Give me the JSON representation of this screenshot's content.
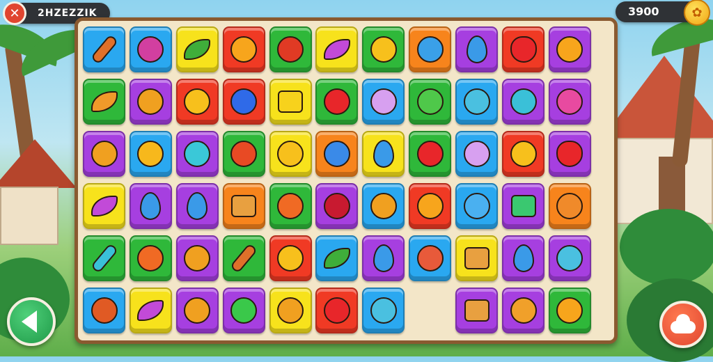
{
  "hud": {
    "player_name": "2HZEZZIK",
    "exit_glyph": "✕",
    "score": "3900",
    "coin_glyph": "✿"
  },
  "colors": {
    "blue": "#2aa8f0",
    "purple": "#a63fe0",
    "yellow": "#f7e21c",
    "red": "#f03a24",
    "green": "#2fb83a",
    "orange": "#f7841c",
    "board_border": "#8a5a30"
  },
  "board": {
    "rows": [
      [
        {
          "color": "blue",
          "icon": "stick-icon"
        },
        {
          "color": "blue",
          "icon": "plum-icon"
        },
        {
          "color": "yellow",
          "icon": "leaf-icon"
        },
        {
          "color": "red",
          "icon": "sun-creature-icon"
        },
        {
          "color": "green",
          "icon": "red-creature-icon"
        },
        {
          "color": "yellow",
          "icon": "eggplant-icon"
        },
        {
          "color": "green",
          "icon": "smiley-icon"
        },
        {
          "color": "orange",
          "icon": "blue-fish-icon"
        },
        {
          "color": "purple",
          "icon": "drop-icon"
        },
        {
          "color": "red",
          "icon": "heart-icon"
        },
        {
          "color": "purple",
          "icon": "sun-creature-icon"
        }
      ],
      [
        {
          "color": "green",
          "icon": "banana-icon"
        },
        {
          "color": "purple",
          "icon": "swirl-icon"
        },
        {
          "color": "red",
          "icon": "smiley-icon"
        },
        {
          "color": "red",
          "icon": "blue-berry-icon"
        },
        {
          "color": "yellow",
          "icon": "cheese-icon"
        },
        {
          "color": "green",
          "icon": "apple-icon"
        },
        {
          "color": "blue",
          "icon": "ghost-icon"
        },
        {
          "color": "green",
          "icon": "frog-icon"
        },
        {
          "color": "blue",
          "icon": "fish-icon"
        },
        {
          "color": "purple",
          "icon": "bean-icon"
        },
        {
          "color": "purple",
          "icon": "candy-icon"
        }
      ],
      [
        {
          "color": "purple",
          "icon": "pizza-icon"
        },
        {
          "color": "blue",
          "icon": "fries-icon"
        },
        {
          "color": "purple",
          "icon": "monster-icon"
        },
        {
          "color": "green",
          "icon": "chair-icon"
        },
        {
          "color": "yellow",
          "icon": "smiley-icon"
        },
        {
          "color": "orange",
          "icon": "gem-icon"
        },
        {
          "color": "yellow",
          "icon": "drop-icon"
        },
        {
          "color": "green",
          "icon": "apple-icon"
        },
        {
          "color": "blue",
          "icon": "ghost-icon"
        },
        {
          "color": "red",
          "icon": "flag-icon"
        },
        {
          "color": "purple",
          "icon": "heart-icon"
        }
      ],
      [
        {
          "color": "yellow",
          "icon": "eggplant-icon"
        },
        {
          "color": "purple",
          "icon": "drop-icon"
        },
        {
          "color": "purple",
          "icon": "drop-icon"
        },
        {
          "color": "orange",
          "icon": "box-icon"
        },
        {
          "color": "green",
          "icon": "carrot-icon"
        },
        {
          "color": "purple",
          "icon": "berry-icon"
        },
        {
          "color": "blue",
          "icon": "swirl-icon"
        },
        {
          "color": "red",
          "icon": "sun-creature-icon"
        },
        {
          "color": "blue",
          "icon": "blob-icon"
        },
        {
          "color": "purple",
          "icon": "house-icon"
        },
        {
          "color": "orange",
          "icon": "cat-icon"
        }
      ],
      [
        {
          "color": "green",
          "icon": "bottle-icon"
        },
        {
          "color": "green",
          "icon": "carrot-icon"
        },
        {
          "color": "purple",
          "icon": "swirl-icon"
        },
        {
          "color": "green",
          "icon": "stick-icon"
        },
        {
          "color": "red",
          "icon": "smiley-icon"
        },
        {
          "color": "blue",
          "icon": "leaf-icon"
        },
        {
          "color": "purple",
          "icon": "drop-icon"
        },
        {
          "color": "blue",
          "icon": "wave-icon"
        },
        {
          "color": "yellow",
          "icon": "box-icon"
        },
        {
          "color": "purple",
          "icon": "drop-icon"
        },
        {
          "color": "purple",
          "icon": "fish-icon"
        }
      ],
      [
        {
          "color": "blue",
          "icon": "tree-icon"
        },
        {
          "color": "yellow",
          "icon": "eggplant-icon"
        },
        {
          "color": "purple",
          "icon": "swirl-icon"
        },
        {
          "color": "purple",
          "icon": "spiral-icon"
        },
        {
          "color": "yellow",
          "icon": "swirl-icon"
        },
        {
          "color": "red",
          "icon": "apple-icon"
        },
        {
          "color": "blue",
          "icon": "fish-icon"
        },
        {
          "color": "none",
          "icon": ""
        },
        {
          "color": "purple",
          "icon": "box-icon"
        },
        {
          "color": "purple",
          "icon": "biscuit-icon"
        },
        {
          "color": "green",
          "icon": "sun-creature-icon"
        }
      ]
    ]
  },
  "buttons": {
    "back": "back-arrow-icon",
    "hint": "cloud-icon"
  }
}
